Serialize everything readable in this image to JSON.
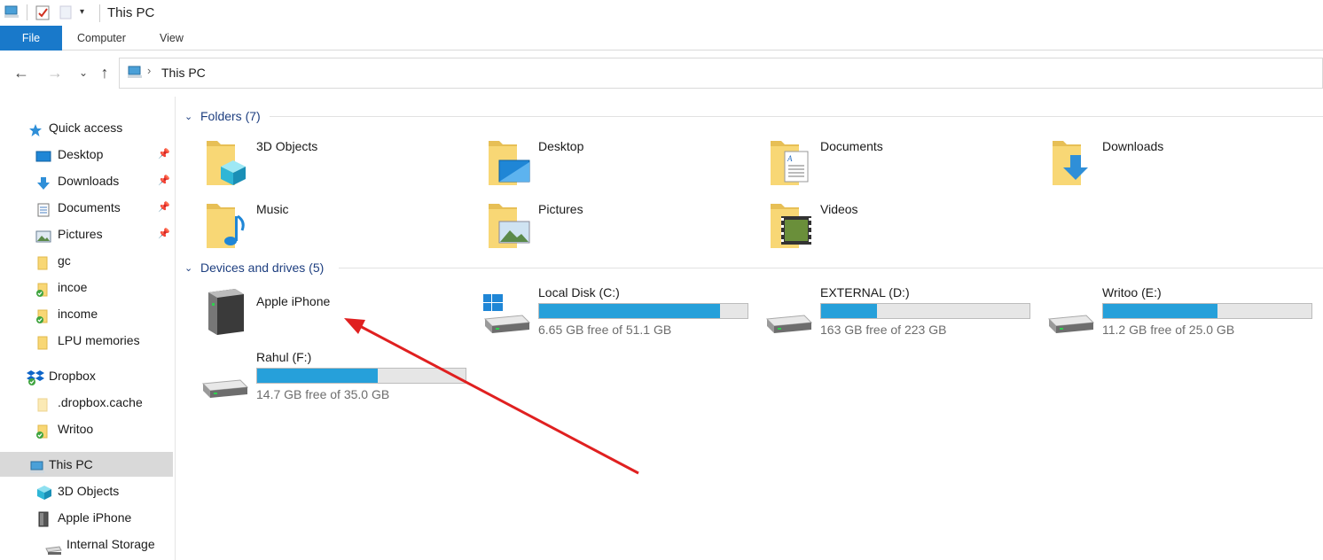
{
  "window": {
    "title": "This PC"
  },
  "ribbon": {
    "tabs": [
      "File",
      "Computer",
      "View"
    ]
  },
  "nav": {
    "path": "This PC"
  },
  "sidebar": {
    "items": [
      {
        "label": "Quick access",
        "icon": "star-icon"
      },
      {
        "label": "Desktop",
        "icon": "desktop-icon",
        "pinned": true
      },
      {
        "label": "Downloads",
        "icon": "download-icon",
        "pinned": true
      },
      {
        "label": "Documents",
        "icon": "documents-icon",
        "pinned": true
      },
      {
        "label": "Pictures",
        "icon": "pictures-icon",
        "pinned": true
      },
      {
        "label": "gc",
        "icon": "folder-icon"
      },
      {
        "label": "incoe",
        "icon": "folder-synced-icon"
      },
      {
        "label": "income",
        "icon": "folder-synced-icon"
      },
      {
        "label": "LPU memories",
        "icon": "folder-icon"
      },
      {
        "label": "Dropbox",
        "icon": "dropbox-icon"
      },
      {
        "label": ".dropbox.cache",
        "icon": "folder-icon"
      },
      {
        "label": "Writoo",
        "icon": "folder-synced-icon"
      },
      {
        "label": "This PC",
        "icon": "computer-icon"
      },
      {
        "label": "3D Objects",
        "icon": "3d-objects-icon"
      },
      {
        "label": "Apple iPhone",
        "icon": "phone-device-icon"
      },
      {
        "label": "Internal Storage",
        "icon": "storage-icon"
      }
    ]
  },
  "folders": {
    "header": "Folders (7)",
    "items": [
      {
        "name": "3D Objects",
        "icon": "3d-objects-folder-icon"
      },
      {
        "name": "Desktop",
        "icon": "desktop-folder-icon"
      },
      {
        "name": "Documents",
        "icon": "documents-folder-icon"
      },
      {
        "name": "Downloads",
        "icon": "downloads-folder-icon"
      },
      {
        "name": "Music",
        "icon": "music-folder-icon"
      },
      {
        "name": "Pictures",
        "icon": "pictures-folder-icon"
      },
      {
        "name": "Videos",
        "icon": "videos-folder-icon"
      }
    ]
  },
  "devices": {
    "header": "Devices and drives (5)",
    "items": [
      {
        "name": "Apple iPhone",
        "icon": "phone-device-icon"
      },
      {
        "name": "Local Disk (C:)",
        "free": "6.65 GB free of 51.1 GB",
        "used_fraction": 0.87,
        "icon": "windows-drive-icon"
      },
      {
        "name": "EXTERNAL (D:)",
        "free": "163 GB free of 223 GB",
        "used_fraction": 0.27,
        "icon": "hard-drive-icon"
      },
      {
        "name": "Writoo (E:)",
        "free": "11.2 GB free of 25.0 GB",
        "used_fraction": 0.55,
        "icon": "hard-drive-icon"
      },
      {
        "name": "Rahul (F:)",
        "free": "14.7 GB free of 35.0 GB",
        "used_fraction": 0.58,
        "icon": "hard-drive-icon"
      }
    ]
  },
  "colors": {
    "accent": "#1979ca",
    "bar": "#26a0da",
    "arrow": "#e02020",
    "folder": "#f8d775"
  }
}
